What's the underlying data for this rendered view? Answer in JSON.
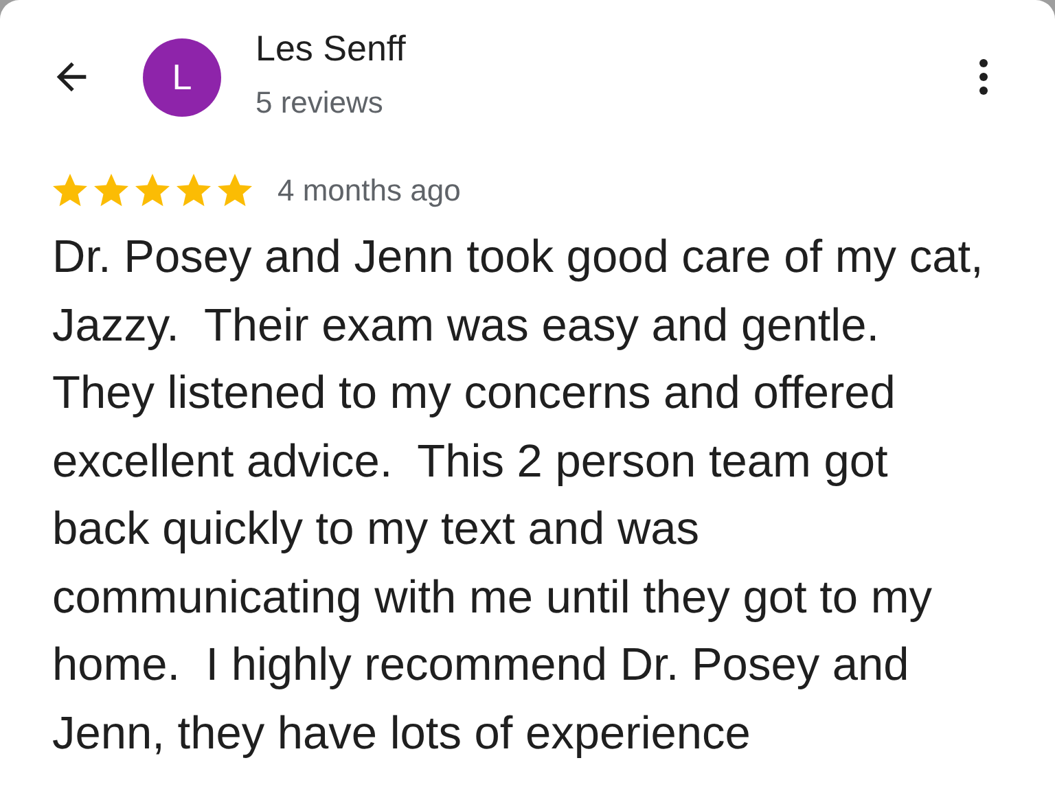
{
  "reviewer": {
    "initial": "L",
    "name": "Les Senff",
    "reviews": "5 reviews"
  },
  "review": {
    "stars": 5,
    "time": "4 months ago",
    "text": "Dr. Posey and Jenn took good care of my cat, Jazzy.  Their exam was easy and gentle. They listened to my concerns and offered excellent advice.  This 2 person team got back quickly to my text and was communicating with me until they got to my home.  I highly recommend Dr. Posey and Jenn, they have lots of experience"
  }
}
